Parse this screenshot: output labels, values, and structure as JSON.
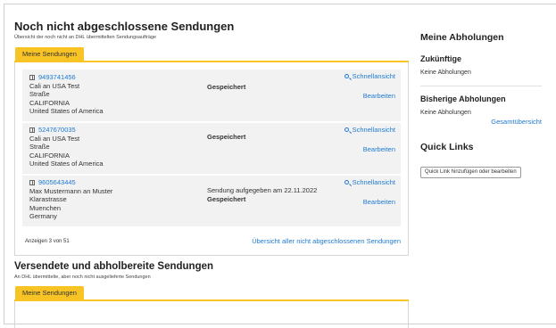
{
  "pending": {
    "title": "Noch nicht abgeschlossene Sendungen",
    "subtitle": "Übersicht der noch nicht an DHL übermittelten Sendungsaufträge",
    "tab": "Meine Sendungen",
    "shipments": [
      {
        "id": "9493741456",
        "addr1": "Cali an USA Test",
        "addr2": "Straße",
        "addr3": "CALIFORNIA",
        "addr4": "United States of America",
        "status_line1": "",
        "status_line2": "Gespeichert",
        "quick": "Schnellansicht",
        "edit": "Bearbeiten"
      },
      {
        "id": "5247670035",
        "addr1": "Cali an USA Test",
        "addr2": "Straße",
        "addr3": "CALIFORNIA",
        "addr4": "United States of America",
        "status_line1": "",
        "status_line2": "Gespeichert",
        "quick": "Schnellansicht",
        "edit": "Bearbeiten"
      },
      {
        "id": "9605643445",
        "addr1": "Max Mustermann an Muster",
        "addr2": "Klarastrasse",
        "addr3": "Muenchen",
        "addr4": "Germany",
        "status_line1": "Sendung aufgegeben am 22.11.2022",
        "status_line2": "Gespeichert",
        "quick": "Schnellansicht",
        "edit": "Bearbeiten"
      }
    ],
    "count_text": "Anzeigen 3 von 51",
    "all_link": "Übersicht aller nicht abgeschlossenen Sendungen"
  },
  "sent": {
    "title": "Versendete und abholbereite Sendungen",
    "subtitle": "An DHL übermittelte, aber noch nicht ausgelieferte Sendungen",
    "tab": "Meine Sendungen"
  },
  "sidebar": {
    "pickups_title": "Meine Abholungen",
    "future_title": "Zukünftige",
    "future_text": "Keine Abholungen",
    "past_title": "Bisherige Abholungen",
    "past_text": "Keine Abholungen",
    "overview_link": "Gesamtübersicht",
    "quicklinks_title": "Quick Links",
    "quicklinks_button": "Quick Link hinzufügen oder bearbeiten"
  },
  "colors": {
    "accent": "#f7c325",
    "link": "#1f7ad2",
    "row_bg": "#f2f2f2"
  },
  "icons": {
    "package": "package-icon",
    "search": "search-icon"
  }
}
